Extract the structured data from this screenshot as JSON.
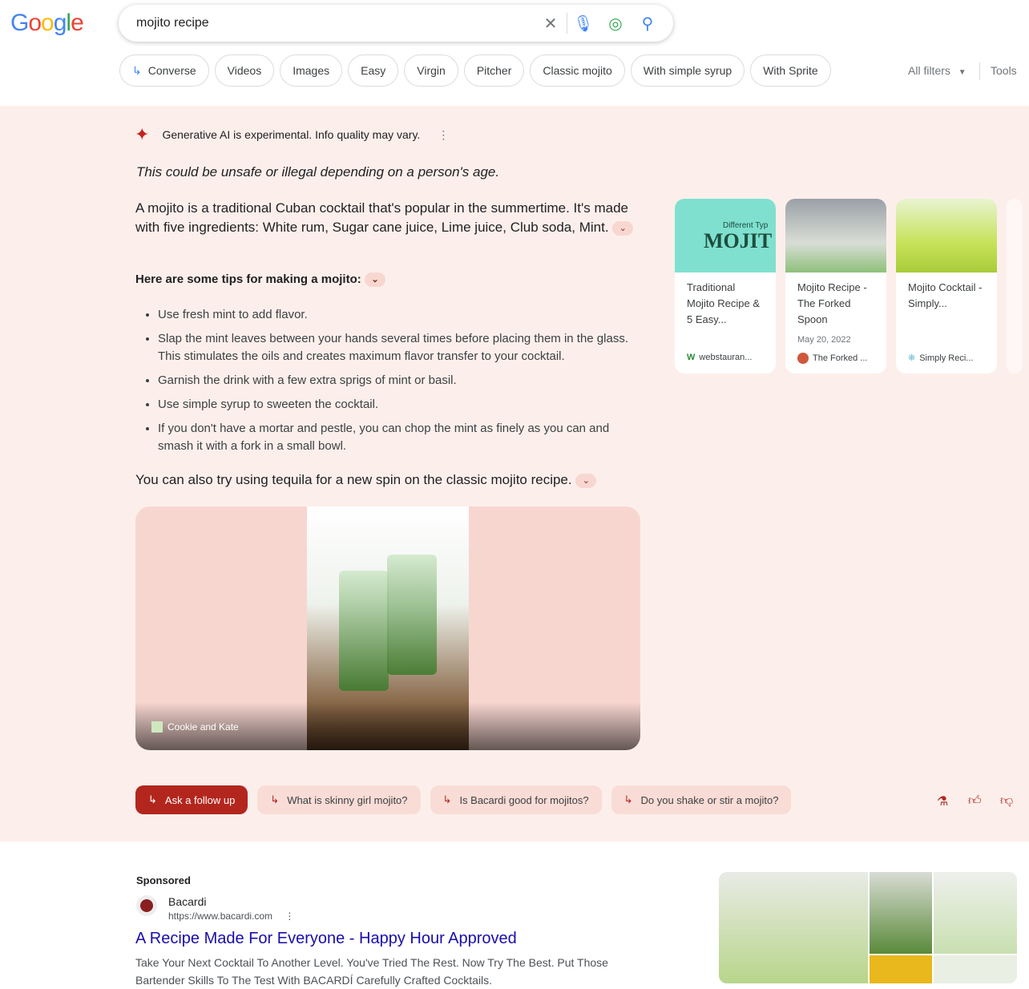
{
  "header": {
    "logo": "Google",
    "query": "mojito recipe",
    "clear_icon": "close-icon",
    "mic_icon": "mic-icon",
    "lens_icon": "lens-icon",
    "search_icon": "search-icon"
  },
  "chips": [
    "Converse",
    "Videos",
    "Images",
    "Easy",
    "Virgin",
    "Pitcher",
    "Classic mojito",
    "With simple syrup",
    "With Sprite"
  ],
  "all_filters": "All filters",
  "tools": "Tools",
  "ai": {
    "disclaimer": "Generative AI is experimental. Info quality may vary.",
    "warning": "This could be unsafe or illegal depending on a person's age.",
    "intro": "A mojito is a traditional Cuban cocktail that's popular in the summertime. It's made with five ingredients: White rum, Sugar cane juice, Lime juice, Club soda, Mint.",
    "tips_heading": "Here are some tips for making a mojito:",
    "tips": [
      "Use fresh mint to add flavor.",
      "Slap the mint leaves between your hands several times before placing them in the glass. This stimulates the oils and creates maximum flavor transfer to your cocktail.",
      "Garnish the drink with a few extra sprigs of mint or basil.",
      "Use simple syrup to sweeten the cocktail.",
      "If you don't have a mortar and pestle, you can chop the mint as finely as you can and smash it with a fork in a small bowl."
    ],
    "also": "You can also try using tequila for a new spin on the classic mojito recipe.",
    "image_source": "Cookie and Kate",
    "cards": [
      {
        "title": "Traditional Mojito Recipe & 5 Easy...",
        "date": "",
        "source": "webstauran...",
        "thumb_text": "MOJIT",
        "thumb_sub": "Different Typ"
      },
      {
        "title": "Mojito Recipe - The Forked Spoon",
        "date": "May 20, 2022",
        "source": "The Forked ..."
      },
      {
        "title": "Mojito Cocktail - Simply...",
        "date": "",
        "source": "Simply Reci..."
      }
    ],
    "followups": [
      "Ask a follow up",
      "What is skinny girl mojito?",
      "Is Bacardi good for mojitos?",
      "Do you shake or stir a mojito?"
    ],
    "accent": "#b3261e"
  },
  "ad": {
    "label": "Sponsored",
    "advertiser": "Bacardi",
    "url": "https://www.bacardi.com",
    "title": "A Recipe Made For Everyone - Happy Hour Approved",
    "description": "Take Your Next Cocktail To Another Level. You've Tried The Rest. Now Try The Best. Put Those Bartender Skills To The Test With BACARDÍ Carefully Crafted Cocktails."
  }
}
